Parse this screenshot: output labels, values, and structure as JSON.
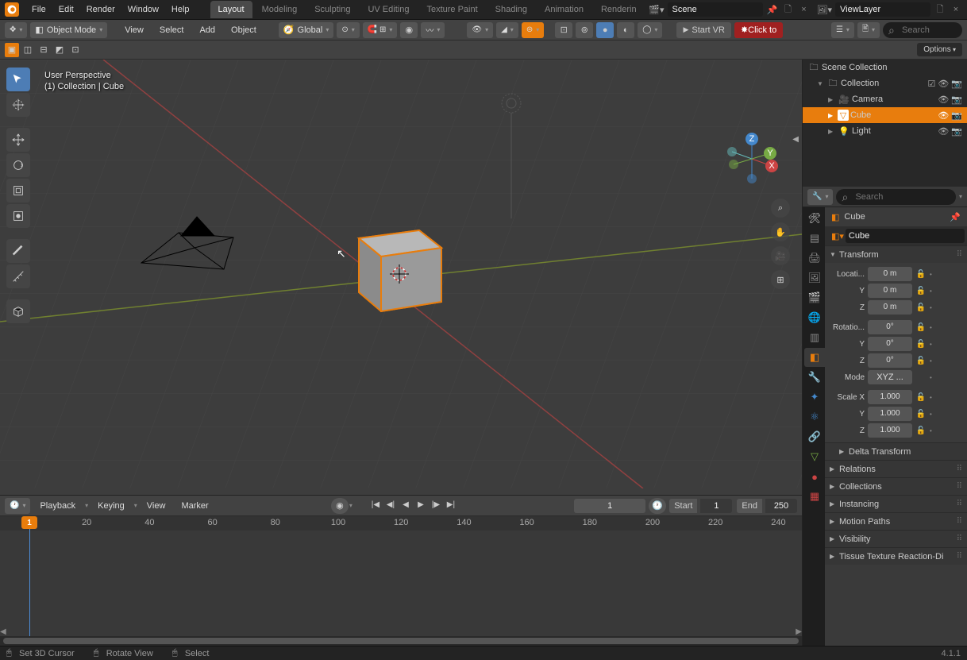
{
  "header": {
    "menus": [
      "File",
      "Edit",
      "Render",
      "Window",
      "Help"
    ],
    "tabs": [
      "Layout",
      "Modeling",
      "Sculpting",
      "UV Editing",
      "Texture Paint",
      "Shading",
      "Animation",
      "Renderin"
    ],
    "active_tab": "Layout",
    "scene_label": "Scene",
    "viewlayer_label": "ViewLayer"
  },
  "toolbar2": {
    "mode": "Object Mode",
    "view": "View",
    "select": "Select",
    "add": "Add",
    "object": "Object",
    "orientation": "Global",
    "start_vr": "Start VR",
    "click_to": "Click to",
    "options": "Options",
    "search_placeholder": "Search"
  },
  "viewport": {
    "overlay_l1": "User Perspective",
    "overlay_l2": "(1) Collection | Cube"
  },
  "outliner": {
    "root": "Scene Collection",
    "collection": "Collection",
    "items": [
      {
        "name": "Camera",
        "icon": "🎥"
      },
      {
        "name": "Cube",
        "icon": "▽",
        "selected": true
      },
      {
        "name": "Light",
        "icon": "💡"
      }
    ]
  },
  "properties": {
    "search_placeholder": "Search",
    "object_name": "Cube",
    "object_data": "Cube",
    "transform_label": "Transform",
    "location_label": "Locati...",
    "rotation_label": "Rotatio...",
    "mode_label": "Mode",
    "mode_value": "XYZ ...",
    "scale_label": "Scale X",
    "location": {
      "x": "0 m",
      "y": "0 m",
      "z": "0 m"
    },
    "rotation": {
      "x": "0°",
      "y": "0°",
      "z": "0°"
    },
    "scale": {
      "x": "1.000",
      "y": "1.000",
      "z": "1.000"
    },
    "delta_label": "Delta Transform",
    "panels": [
      "Relations",
      "Collections",
      "Instancing",
      "Motion Paths",
      "Visibility",
      "Tissue Texture Reaction-Di"
    ]
  },
  "timeline": {
    "playback": "Playback",
    "keying": "Keying",
    "view": "View",
    "marker": "Marker",
    "current": "1",
    "start_label": "Start",
    "start": "1",
    "end_label": "End",
    "end": "250",
    "ticks": [
      1,
      20,
      40,
      60,
      80,
      100,
      120,
      140,
      160,
      180,
      200,
      220,
      240
    ],
    "playhead": "1"
  },
  "statusbar": {
    "set_cursor": "Set 3D Cursor",
    "rotate": "Rotate View",
    "select": "Select",
    "version": "4.1.1"
  }
}
